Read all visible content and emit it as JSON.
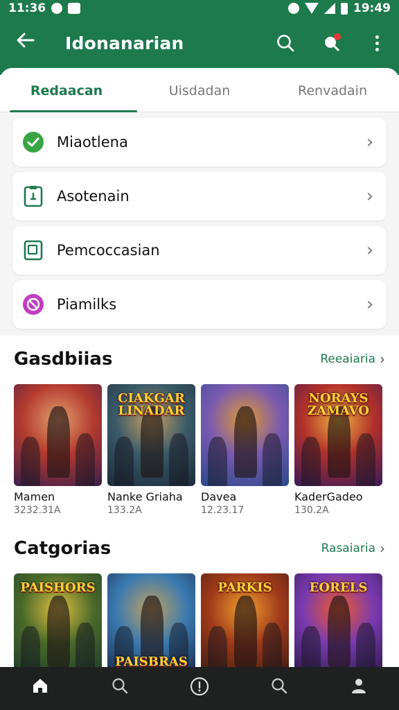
{
  "status_bar": {
    "time_left": "11:36",
    "time_right": "19:49"
  },
  "app_bar": {
    "title": "Idonanarian",
    "back_icon": "arrow-left-icon",
    "actions": [
      "search-icon",
      "notification-icon",
      "more-vert-icon"
    ]
  },
  "tabs": [
    {
      "label": "Redaacan",
      "active": true
    },
    {
      "label": "Uisdadan",
      "active": false
    },
    {
      "label": "Renvadain",
      "active": false
    }
  ],
  "menu_items": [
    {
      "label": "Miaotlena",
      "icon": "check-circle-icon",
      "color": "#3aa544"
    },
    {
      "label": "Asotenain",
      "icon": "clipboard-icon",
      "color": "#1d7a4d"
    },
    {
      "label": "Pemcoccasian",
      "icon": "phone-icon",
      "color": "#1d7a4d"
    },
    {
      "label": "Piamilks",
      "icon": "block-icon",
      "color": "#c23cc2"
    }
  ],
  "section1": {
    "title": "Gasdbiias",
    "link": "Reeaiaria",
    "items": [
      {
        "name": "Mamen",
        "meta": "3232.31A",
        "logo": "",
        "colors": [
          "#3a1d4a",
          "#b43a2e",
          "#e0a070"
        ]
      },
      {
        "name": "Nanke Griaha",
        "meta": "133.2A",
        "logo": "CIAKGAR LINADAR",
        "colors": [
          "#1c2a3a",
          "#3a5a6a",
          "#c8a060"
        ]
      },
      {
        "name": "Davea",
        "meta": "12.23.17",
        "logo": "",
        "colors": [
          "#2a4a8a",
          "#7a5ab0",
          "#e09a30"
        ]
      },
      {
        "name": "KaderGadeo",
        "meta": "130.2A",
        "logo": "NORAYS ZAMAVO",
        "colors": [
          "#3a1a5a",
          "#b0302a",
          "#f0b040"
        ]
      }
    ]
  },
  "section2": {
    "title": "Catgorias",
    "link": "Rasaiaria",
    "items": [
      {
        "logo": "PAISHORS",
        "colors": [
          "#1a3a2a",
          "#4a6a2a",
          "#e0c040"
        ]
      },
      {
        "logo": "PAISBRAS",
        "colors": [
          "#1a2a4a",
          "#3a7ab0",
          "#c0a060"
        ]
      },
      {
        "logo": "PARKIS",
        "colors": [
          "#3a1a10",
          "#a03a1a",
          "#f0a030"
        ]
      },
      {
        "logo": "EORELS",
        "colors": [
          "#2a1a4a",
          "#7a3ab0",
          "#f05a2a"
        ]
      }
    ]
  },
  "bottom_nav": [
    {
      "icon": "home-icon",
      "label": ""
    },
    {
      "icon": "search-icon",
      "label": ""
    },
    {
      "icon": "info-icon",
      "label": ""
    },
    {
      "icon": "search-icon",
      "label": ""
    },
    {
      "icon": "profile-icon",
      "label": ""
    }
  ]
}
